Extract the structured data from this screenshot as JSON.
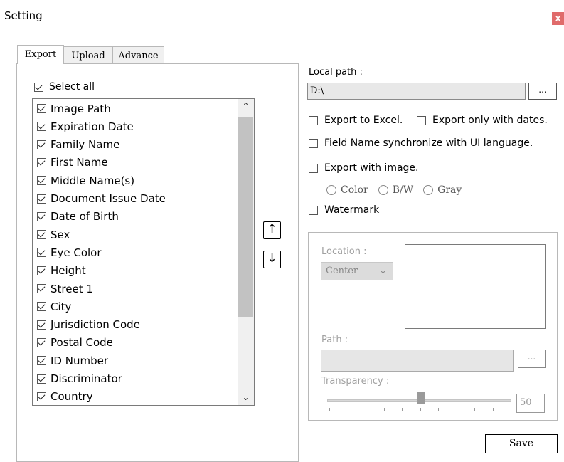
{
  "window": {
    "title": "Setting",
    "close_glyph": "x"
  },
  "tabs": [
    {
      "label": "Export"
    },
    {
      "label": "Upload"
    },
    {
      "label": "Advance"
    }
  ],
  "export": {
    "select_all_label": "Select all",
    "select_all_checked": true,
    "fields": [
      "Image Path",
      "Expiration Date",
      "Family Name",
      "First Name",
      "Middle Name(s)",
      "Document Issue Date",
      "Date of Birth",
      "Sex",
      "Eye Color",
      "Height",
      "Street 1",
      "City",
      "Jurisdiction Code",
      "Postal Code",
      "ID Number",
      "Discriminator",
      "Country"
    ],
    "all_fields_checked": true,
    "move_up_icon": "arrow-up-icon",
    "move_down_icon": "arrow-down-icon"
  },
  "options": {
    "local_path_label": "Local path :",
    "local_path_value": "D:\\",
    "browse_label": "...",
    "export_to_excel": "Export to Excel.",
    "export_only_with_dates": "Export only with dates.",
    "field_name_sync": "Field Name synchronize with UI language.",
    "export_with_image": "Export with image.",
    "image_modes": [
      "Color",
      "B/W",
      "Gray"
    ],
    "watermark": "Watermark"
  },
  "watermark": {
    "location_label": "Location :",
    "location_value": "Center",
    "path_label": "Path :",
    "browse_label": "...",
    "transparency_label": "Transparency :",
    "transparency_value": "50"
  },
  "save_label": "Save"
}
